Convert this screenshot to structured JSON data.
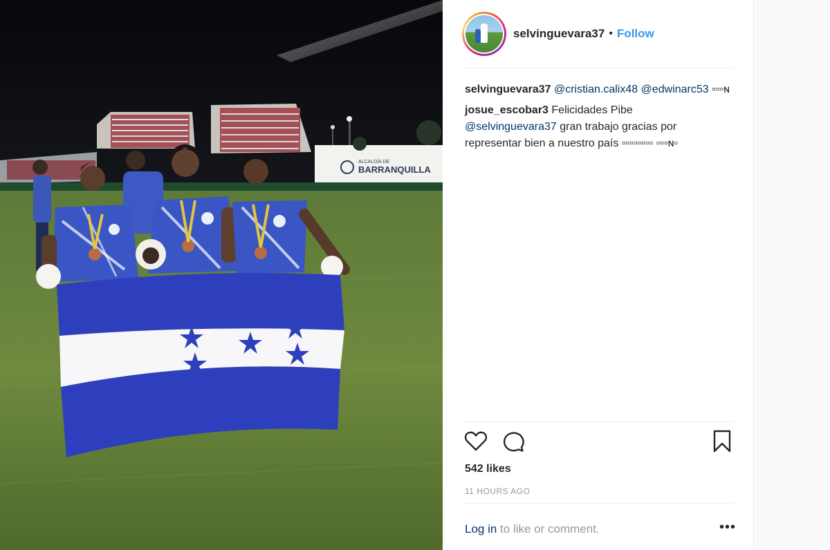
{
  "post": {
    "username": "selvinguevara37",
    "separator": "•",
    "follow_label": "Follow",
    "avatar_icon": "profile-avatar"
  },
  "comments": [
    {
      "user": "selvinguevara37",
      "mention1": "@cristian.calix48",
      "mention2": "@edwinarc53",
      "trailing": " ▫▫▫ɴ"
    },
    {
      "user": "josue_escobar3",
      "text1": " Felicidades Pibe",
      "mention": "@selvinguevara37",
      "text2": " gran trabajo gracias por representar bien a nuestro país ▫▫▫▫▫▫▫▫ ▫▫▫ɴ▫"
    }
  ],
  "actions": {
    "like_icon": "heart-icon",
    "comment_icon": "comment-icon",
    "save_icon": "bookmark-icon"
  },
  "likes": "542 likes",
  "timestamp": "11 HOURS AGO",
  "login": {
    "link": "Log in",
    "text": " to like or comment.",
    "more": "•••"
  },
  "photo": {
    "billboard_line1": "ALCALDÍA DE",
    "billboard_line2": "BARRANQUILLA"
  },
  "colors": {
    "link_blue": "#3897f0",
    "mention_blue": "#003569",
    "muted": "#999999",
    "text": "#262626"
  }
}
